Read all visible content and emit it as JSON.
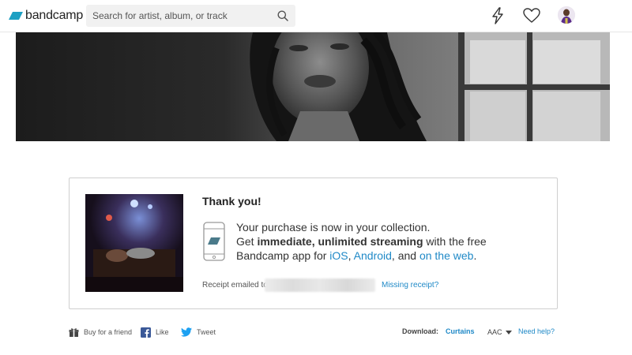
{
  "header": {
    "logo_text": "bandcamp",
    "search_placeholder": "Search for artist, album, or track",
    "icons": [
      "lightning-icon",
      "heart-icon",
      "user-avatar"
    ],
    "brand_color": "#1da0c3"
  },
  "banner": {
    "description_icon": "artist-banner-image"
  },
  "thank_you": {
    "title": "Thank you!",
    "line1": "Your purchase is now in your collection.",
    "line2_prefix": "Get ",
    "line2_bold": "immediate, unlimited streaming",
    "line2_suffix": " with the free",
    "line3_prefix": "Bandcamp app for ",
    "link_ios": "iOS",
    "sep1": ", ",
    "link_android": "Android",
    "sep2": ", and ",
    "link_web": "on the web",
    "end": ".",
    "receipt_label": "Receipt emailed to",
    "missing_receipt": "Missing receipt?"
  },
  "actions": {
    "gift_label": "Buy for a friend",
    "like_label": "Like",
    "tweet_label": "Tweet"
  },
  "download": {
    "label": "Download:",
    "title": "Curtains",
    "format": "AAC",
    "help": "Need help?"
  },
  "colors": {
    "link": "#1f89c7",
    "facebook": "#3b5998",
    "twitter": "#1da1f2"
  }
}
